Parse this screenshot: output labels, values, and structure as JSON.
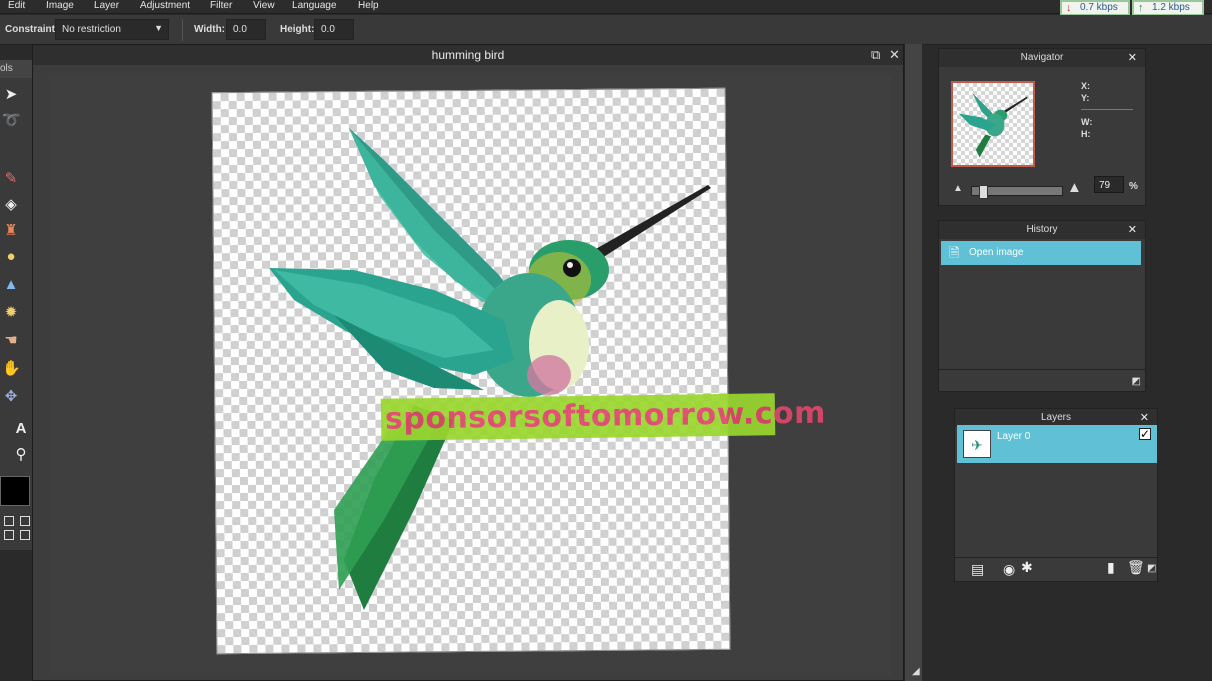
{
  "menu": {
    "items": [
      "Edit",
      "Image",
      "Layer",
      "Adjustment",
      "Filter",
      "View",
      "Language",
      "Help"
    ]
  },
  "network": {
    "download": "0.7 kbps",
    "upload": "1.2 kbps",
    "down_icon": "arrow-down-icon",
    "up_icon": "arrow-up-icon"
  },
  "options": {
    "constraint_label": "Constraint:",
    "constraint_value": "No restriction",
    "width_label": "Width:",
    "width_value": "0.0",
    "height_label": "Height:",
    "height_value": "0.0"
  },
  "tools": {
    "header": "ols"
  },
  "document": {
    "title": "humming bird"
  },
  "watermark": {
    "text": "sponsorsoftomorrow.com"
  },
  "navigator": {
    "title": "Navigator",
    "x_label": "X:",
    "y_label": "Y:",
    "w_label": "W:",
    "h_label": "H:",
    "zoom": "79",
    "zoom_unit": "%"
  },
  "history": {
    "title": "History",
    "items": [
      "Open image"
    ]
  },
  "layers": {
    "title": "Layers",
    "items": [
      {
        "name": "Layer 0",
        "visible": true
      }
    ]
  },
  "colors": {
    "accent": "#5fc0d6",
    "watermark_bg": "#9ad72e",
    "watermark_text": "#e0466b"
  }
}
